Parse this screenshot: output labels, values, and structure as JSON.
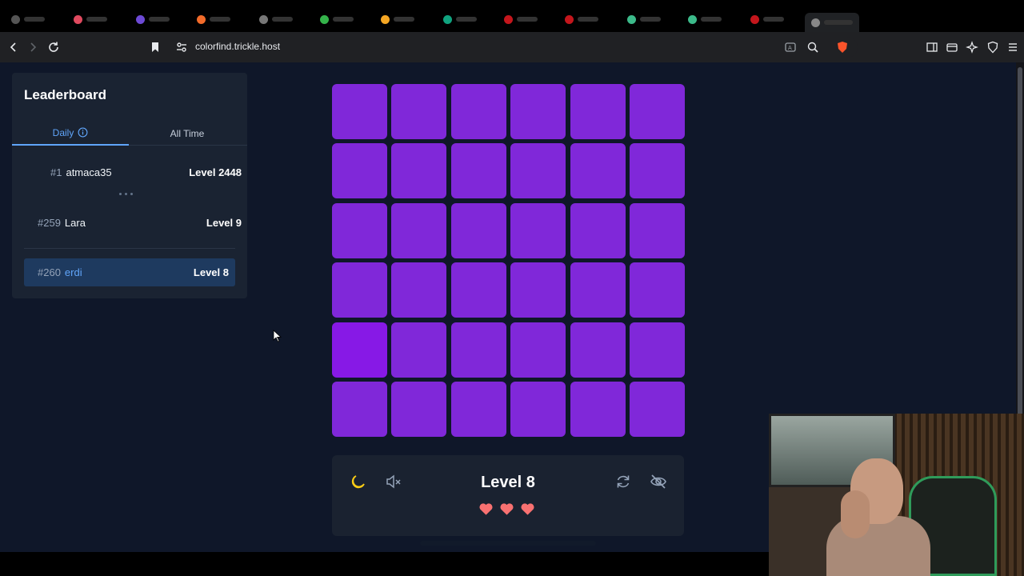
{
  "browser": {
    "url": "colorfind.trickle.host"
  },
  "leaderboard": {
    "title": "Leaderboard",
    "tabs": [
      {
        "label": "Daily",
        "active": true
      },
      {
        "label": "All Time",
        "active": false
      }
    ],
    "entries": [
      {
        "rank": "#1",
        "name": "atmaca35",
        "level": "Level 2448"
      },
      {
        "rank": "#259",
        "name": "Lara",
        "level": "Level 9"
      },
      {
        "rank": "#260",
        "name": "erdi",
        "level": "Level 8",
        "current_user": true
      }
    ]
  },
  "game": {
    "grid_size": 6,
    "base_color": "#8028d9",
    "odd_color": "#8719e6",
    "level_label": "Level 8",
    "lives": 3,
    "heart_color": "#f87171",
    "icons": [
      "moon-icon",
      "mute-icon",
      "restart-icon",
      "eye-off-icon"
    ]
  },
  "colors": {
    "accent": "#60a5fa",
    "page_bg": "#0f1729",
    "panel_bg": "#1a2332"
  }
}
